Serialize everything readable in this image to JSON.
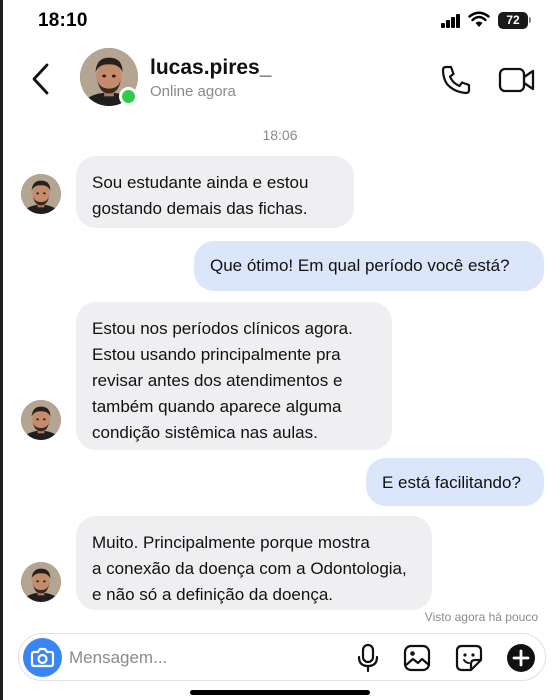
{
  "status_bar": {
    "time": "18:10",
    "battery": "72"
  },
  "header": {
    "name": "lucas.pires_",
    "status": "Online agora",
    "icons": {
      "back": "chevron-left-icon",
      "call": "phone-icon",
      "video": "video-camera-icon"
    }
  },
  "chat": {
    "timestamp": "18:06",
    "messages": [
      {
        "from": "contact",
        "lines": [
          "Sou estudante ainda e estou",
          "gostando demais das fichas."
        ]
      },
      {
        "from": "me",
        "lines": [
          "Que ótimo! Em qual período você está?"
        ]
      },
      {
        "from": "contact",
        "lines": [
          "Estou nos períodos clínicos agora.",
          "Estou usando principalmente pra",
          "revisar antes dos atendimentos e",
          "também quando aparece alguma",
          "condição sistêmica nas aulas."
        ]
      },
      {
        "from": "me",
        "lines": [
          "E está facilitando?"
        ]
      },
      {
        "from": "contact",
        "lines": [
          "Muito. Principalmente porque mostra",
          "a conexão da doença com a Odontologia,",
          "e não só a definição da doença."
        ]
      }
    ],
    "seen": "Visto agora há pouco"
  },
  "composer": {
    "placeholder": "Mensagem...",
    "icons": {
      "camera": "camera-icon",
      "mic": "microphone-icon",
      "gallery": "gallery-icon",
      "sticker": "sticker-icon",
      "plus": "plus-icon"
    }
  },
  "colors": {
    "online": "#33c94a",
    "incoming": "#efeff1",
    "outgoing": "#dbe6fb",
    "camera": "#3a85f5"
  }
}
